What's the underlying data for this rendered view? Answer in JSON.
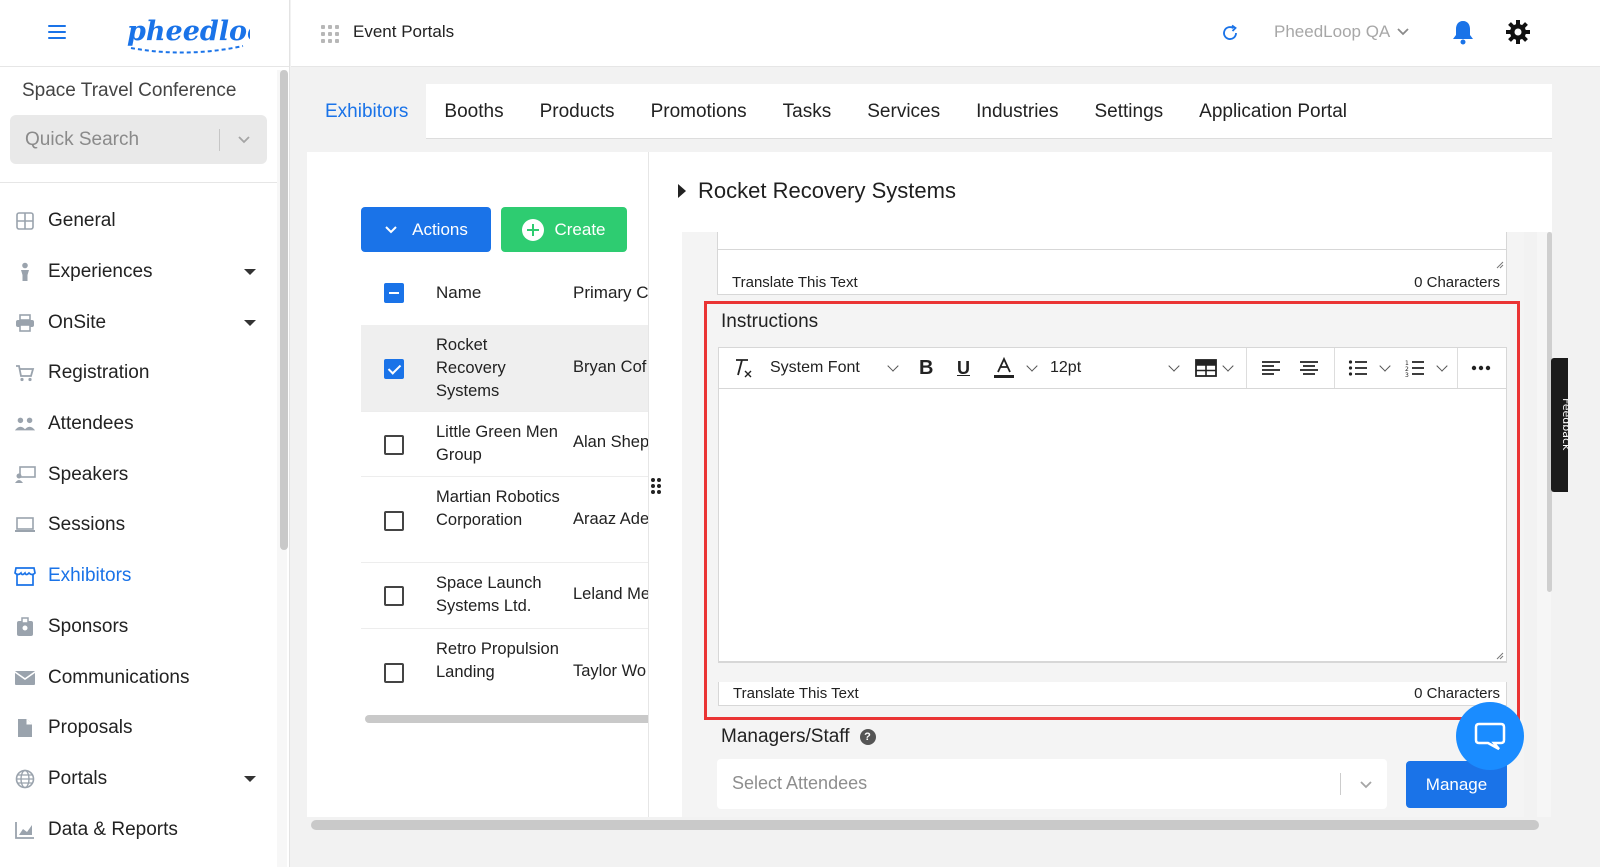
{
  "app": {
    "logo_text": "pheedloop",
    "conference_name": "Space Travel Conference",
    "quick_search_placeholder": "Quick Search"
  },
  "topbar": {
    "section_label": "Event Portals",
    "org_name": "PheedLoop QA"
  },
  "sidebar": {
    "items": [
      {
        "label": "General",
        "icon": "grid-icon",
        "has_submenu": false
      },
      {
        "label": "Experiences",
        "icon": "person-icon",
        "has_submenu": true
      },
      {
        "label": "OnSite",
        "icon": "printer-icon",
        "has_submenu": true
      },
      {
        "label": "Registration",
        "icon": "cart-icon",
        "has_submenu": false
      },
      {
        "label": "Attendees",
        "icon": "people-icon",
        "has_submenu": false
      },
      {
        "label": "Speakers",
        "icon": "presenter-icon",
        "has_submenu": false
      },
      {
        "label": "Sessions",
        "icon": "laptop-icon",
        "has_submenu": false
      },
      {
        "label": "Exhibitors",
        "icon": "store-icon",
        "has_submenu": false,
        "active": true
      },
      {
        "label": "Sponsors",
        "icon": "badge-icon",
        "has_submenu": false
      },
      {
        "label": "Communications",
        "icon": "mail-icon",
        "has_submenu": false
      },
      {
        "label": "Proposals",
        "icon": "document-icon",
        "has_submenu": false
      },
      {
        "label": "Portals",
        "icon": "globe-icon",
        "has_submenu": true
      },
      {
        "label": "Data & Reports",
        "icon": "chart-icon",
        "has_submenu": false
      }
    ]
  },
  "tabs": [
    {
      "label": "Exhibitors",
      "active": true
    },
    {
      "label": "Booths"
    },
    {
      "label": "Products"
    },
    {
      "label": "Promotions"
    },
    {
      "label": "Tasks"
    },
    {
      "label": "Services"
    },
    {
      "label": "Industries"
    },
    {
      "label": "Settings"
    },
    {
      "label": "Application Portal"
    }
  ],
  "list": {
    "actions_label": "Actions",
    "create_label": "Create",
    "columns": [
      "Name",
      "Primary C"
    ],
    "rows": [
      {
        "name": "Rocket Recovery Systems",
        "contact": "Bryan Cof",
        "checked": true
      },
      {
        "name": "Little Green Men Group",
        "contact": "Alan Shep",
        "checked": false
      },
      {
        "name": "Martian Robotics Corporation",
        "contact": "Araaz Ade",
        "checked": false
      },
      {
        "name": "Space Launch Systems Ltd.",
        "contact": "Leland Me",
        "checked": false
      },
      {
        "name": "Retro Propulsion Landing",
        "contact": "Taylor Wo",
        "checked": false
      }
    ]
  },
  "detail": {
    "title": "Rocket Recovery Systems",
    "prev_field": {
      "translate_label": "Translate This Text",
      "char_count": "0 Characters"
    },
    "instructions": {
      "label": "Instructions",
      "font_family": "System Font",
      "font_size": "12pt",
      "translate_label": "Translate This Text",
      "char_count": "0 Characters"
    },
    "managers": {
      "label": "Managers/Staff",
      "help": "?",
      "select_placeholder": "Select Attendees",
      "manage_label": "Manage"
    },
    "feedback_label": "Feedback"
  },
  "colors": {
    "accent": "#1a73e8",
    "create_green": "#2ecc71",
    "highlight_red": "#ea3434",
    "chat_blue": "#1a8cff"
  }
}
